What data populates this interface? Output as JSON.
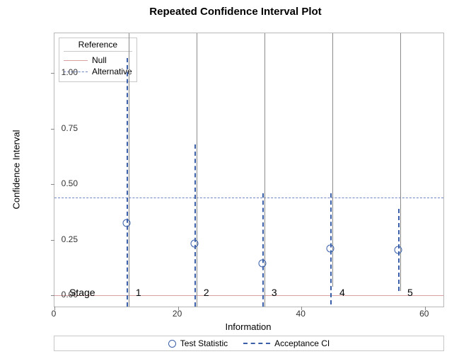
{
  "chart_data": {
    "type": "scatter",
    "title": "Repeated Confidence Interval Plot",
    "xlabel": "Information",
    "ylabel": "Confidence Interval",
    "xlim": [
      0,
      63
    ],
    "ylim": [
      -0.05,
      1.18
    ],
    "xticks": [
      0,
      20,
      40,
      60
    ],
    "yticks": [
      0.0,
      0.25,
      0.5,
      0.75,
      1.0
    ],
    "references": {
      "null_y": 0.0,
      "alternative_y": 0.44
    },
    "stage_label": "Stage",
    "stages": [
      {
        "n": 1,
        "x": 12,
        "stat": 0.325,
        "ci_lo": -0.42,
        "ci_hi": 1.07,
        "solid_lo": -0.3,
        "solid_hi": 1.18
      },
      {
        "n": 2,
        "x": 23,
        "stat": 0.235,
        "ci_lo": -0.2,
        "ci_hi": 0.68,
        "solid_lo": -0.1,
        "solid_hi": 1.18
      },
      {
        "n": 3,
        "x": 34,
        "stat": 0.145,
        "ci_lo": -0.17,
        "ci_hi": 0.46,
        "solid_lo": -0.06,
        "solid_hi": 1.18
      },
      {
        "n": 4,
        "x": 45,
        "stat": 0.21,
        "ci_lo": -0.04,
        "ci_hi": 0.46,
        "solid_lo": 0.04,
        "solid_hi": 1.18
      },
      {
        "n": 5,
        "x": 56,
        "stat": 0.205,
        "ci_lo": 0.02,
        "ci_hi": 0.39,
        "solid_lo": 0.02,
        "solid_hi": 1.18
      }
    ],
    "legend_inner": {
      "header": "Reference",
      "items": [
        "Null",
        "Alternative"
      ]
    },
    "legend_bottom": {
      "point": "Test Statistic",
      "ci": "Acceptance CI"
    }
  }
}
